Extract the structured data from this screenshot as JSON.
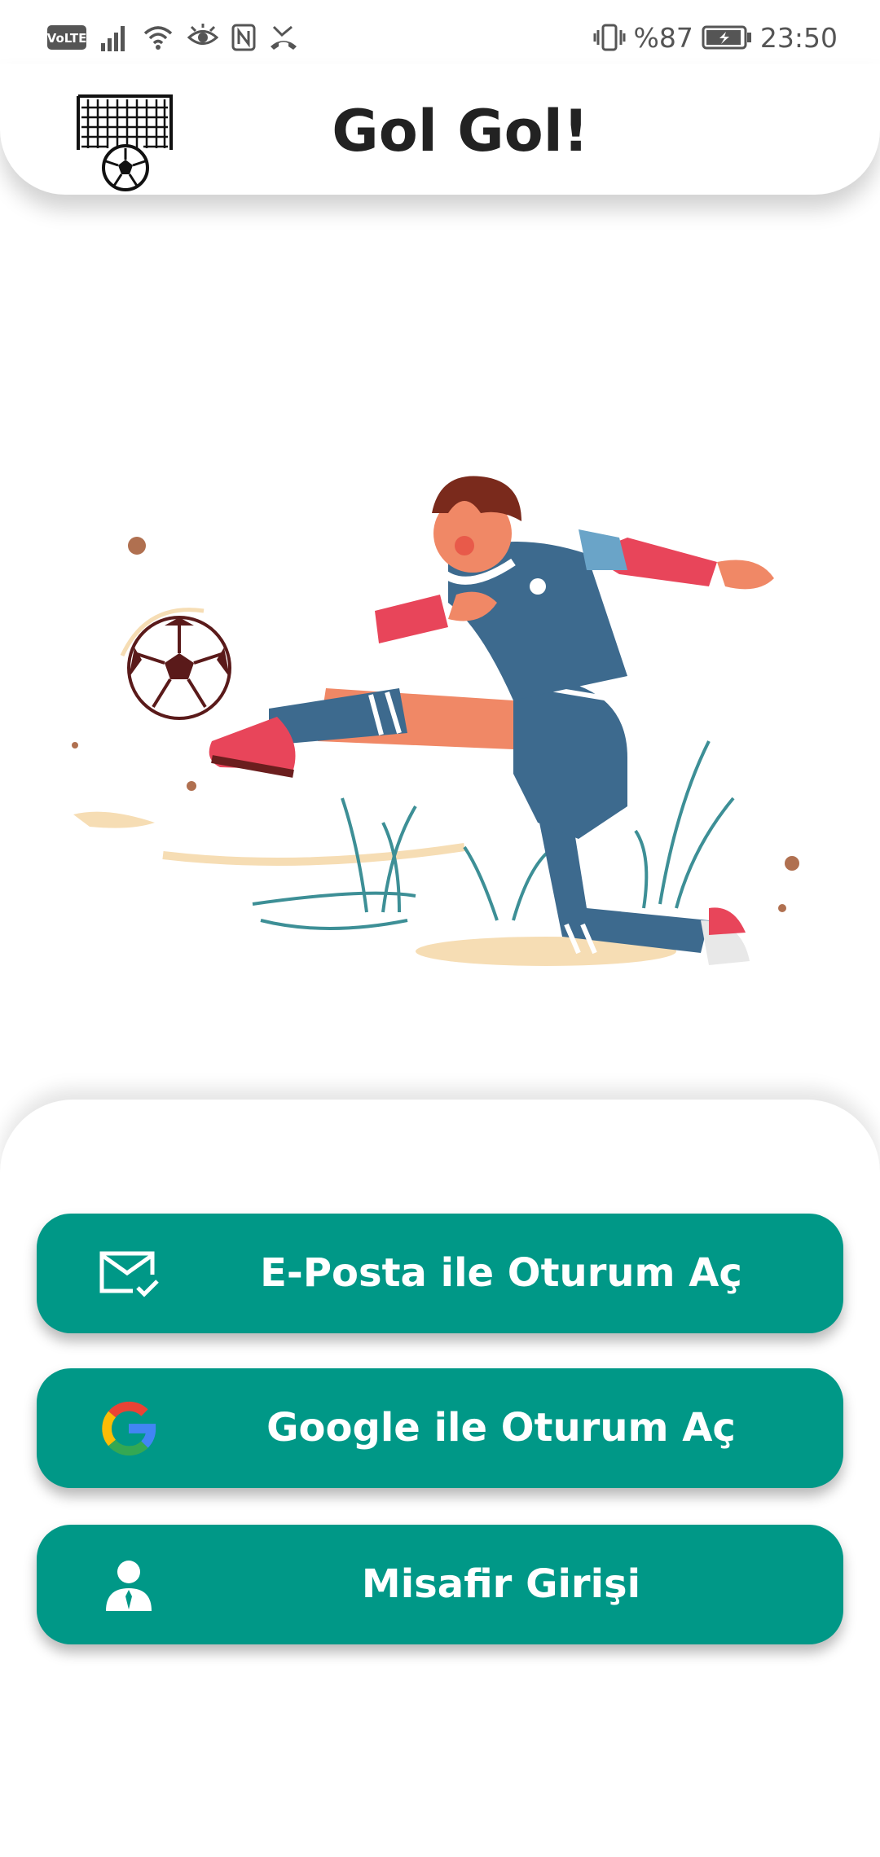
{
  "status_bar": {
    "volte_label": "VoLTE",
    "battery_percent": "%87",
    "time": "23:50",
    "icons": [
      "signal-icon",
      "wifi-icon",
      "eye-icon",
      "nfc-icon",
      "missed-call-icon",
      "vibrate-icon",
      "battery-charging-icon"
    ]
  },
  "header": {
    "title": "Gol Gol!",
    "logo_icon": "goal-net-ball-icon"
  },
  "hero": {
    "illustration": "soccer-player-kicking-ball"
  },
  "buttons": {
    "email_login": {
      "label": "E-Posta ile Oturum Aç",
      "icon": "mail-check-icon"
    },
    "google_login": {
      "label": "Google ile Oturum Aç",
      "icon": "google-g-icon"
    },
    "guest_login": {
      "label": "Misafir Girişi",
      "icon": "user-icon"
    }
  },
  "colors": {
    "button_bg": "#009887",
    "button_text": "#ffffff",
    "title_text": "#222222"
  }
}
